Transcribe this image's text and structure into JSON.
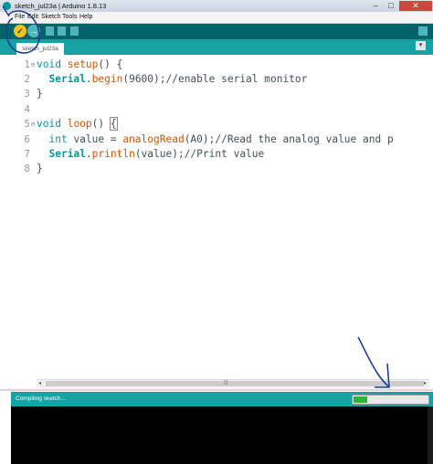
{
  "window": {
    "title": "sketch_jul23a | Arduino 1.8.13",
    "icon": "arduino-icon",
    "minimize_glyph": "–",
    "maximize_glyph": "□",
    "close_glyph": "✕"
  },
  "menu": {
    "items": [
      "File",
      "Edit",
      "Sketch",
      "Tools",
      "Help"
    ]
  },
  "toolbar": {
    "verify_glyph": "✓",
    "upload_glyph": "→",
    "buttons": [
      "verify-icon",
      "upload-icon",
      "new-icon",
      "open-icon",
      "save-icon",
      "serial-monitor-icon"
    ],
    "accent_color": "#006468"
  },
  "tab": {
    "label": "sketch_jul23a",
    "menu_glyph": "▾"
  },
  "editor": {
    "line_numbers": [
      "1",
      "2",
      "3",
      "4",
      "5",
      "6",
      "7",
      "8"
    ],
    "fold_marker": "⊟",
    "code": {
      "l1": {
        "kw1": "void",
        "fn1": "setup",
        "rest": "() {"
      },
      "l2": {
        "indent": "  ",
        "obj": "Serial",
        "dot": ".",
        "fn": "begin",
        "rest": "(9600);//enable serial monitor"
      },
      "l3": {
        "text": "}"
      },
      "l4": {
        "text": ""
      },
      "l5": {
        "kw1": "void",
        "fn1": "loop",
        "rest": "() ",
        "brace": "{"
      },
      "l6": {
        "indent": "  ",
        "kw": "int",
        "mid": " value = ",
        "fn": "analogRead",
        "rest": "(A0);//Read the analog value and p"
      },
      "l7": {
        "indent": "  ",
        "obj": "Serial",
        "dot": ".",
        "fn": "println",
        "rest": "(value);//Print value"
      },
      "l8": {
        "text": "}"
      }
    },
    "scroll_left": "◂",
    "scroll_right": "▸",
    "scroll_grip": "|||"
  },
  "status": {
    "text": "Compiling sketch...",
    "progress": 0.18,
    "progress_color": "#2fb531"
  }
}
